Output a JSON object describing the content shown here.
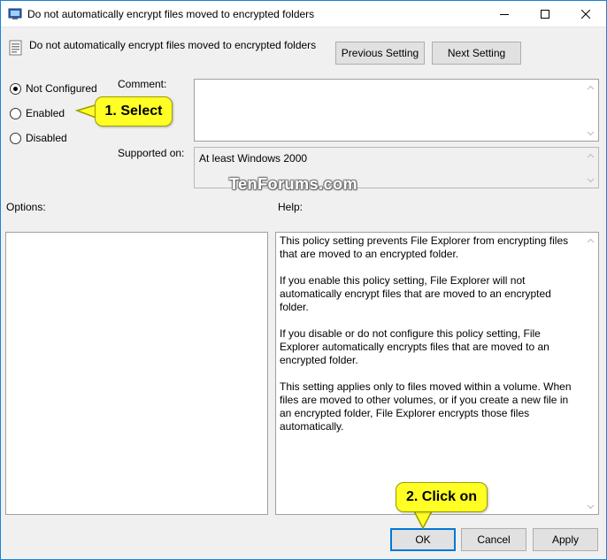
{
  "window": {
    "title": "Do not automatically encrypt files moved to encrypted folders",
    "accent_color": "#0078d7"
  },
  "header": {
    "setting_name": "Do not automatically encrypt files moved to encrypted folders",
    "previous_label": "Previous Setting",
    "next_label": "Next Setting"
  },
  "state": {
    "options": [
      {
        "label": "Not Configured",
        "checked": true
      },
      {
        "label": "Enabled",
        "checked": false
      },
      {
        "label": "Disabled",
        "checked": false
      }
    ]
  },
  "comment": {
    "label": "Comment:",
    "value": ""
  },
  "supported": {
    "label": "Supported on:",
    "value": "At least Windows 2000"
  },
  "options_panel": {
    "label": "Options:"
  },
  "help_panel": {
    "label": "Help:",
    "paragraphs": [
      "This policy setting prevents File Explorer from encrypting files that are moved to an encrypted folder.",
      "If you enable this policy setting, File Explorer will not automatically encrypt files that are moved to an encrypted folder.",
      "If you disable or do not configure this policy setting, File Explorer automatically encrypts files that are moved to an encrypted folder.",
      "This setting applies only to files moved within a volume. When files are moved to other volumes, or if you create a new file in an encrypted folder, File Explorer encrypts those files automatically."
    ]
  },
  "footer": {
    "ok_label": "OK",
    "cancel_label": "Cancel",
    "apply_label": "Apply"
  },
  "annotations": {
    "callout_select": "1. Select",
    "callout_click": "2. Click on",
    "callout_color": "#ffff26",
    "watermark": "TenForums.com"
  }
}
